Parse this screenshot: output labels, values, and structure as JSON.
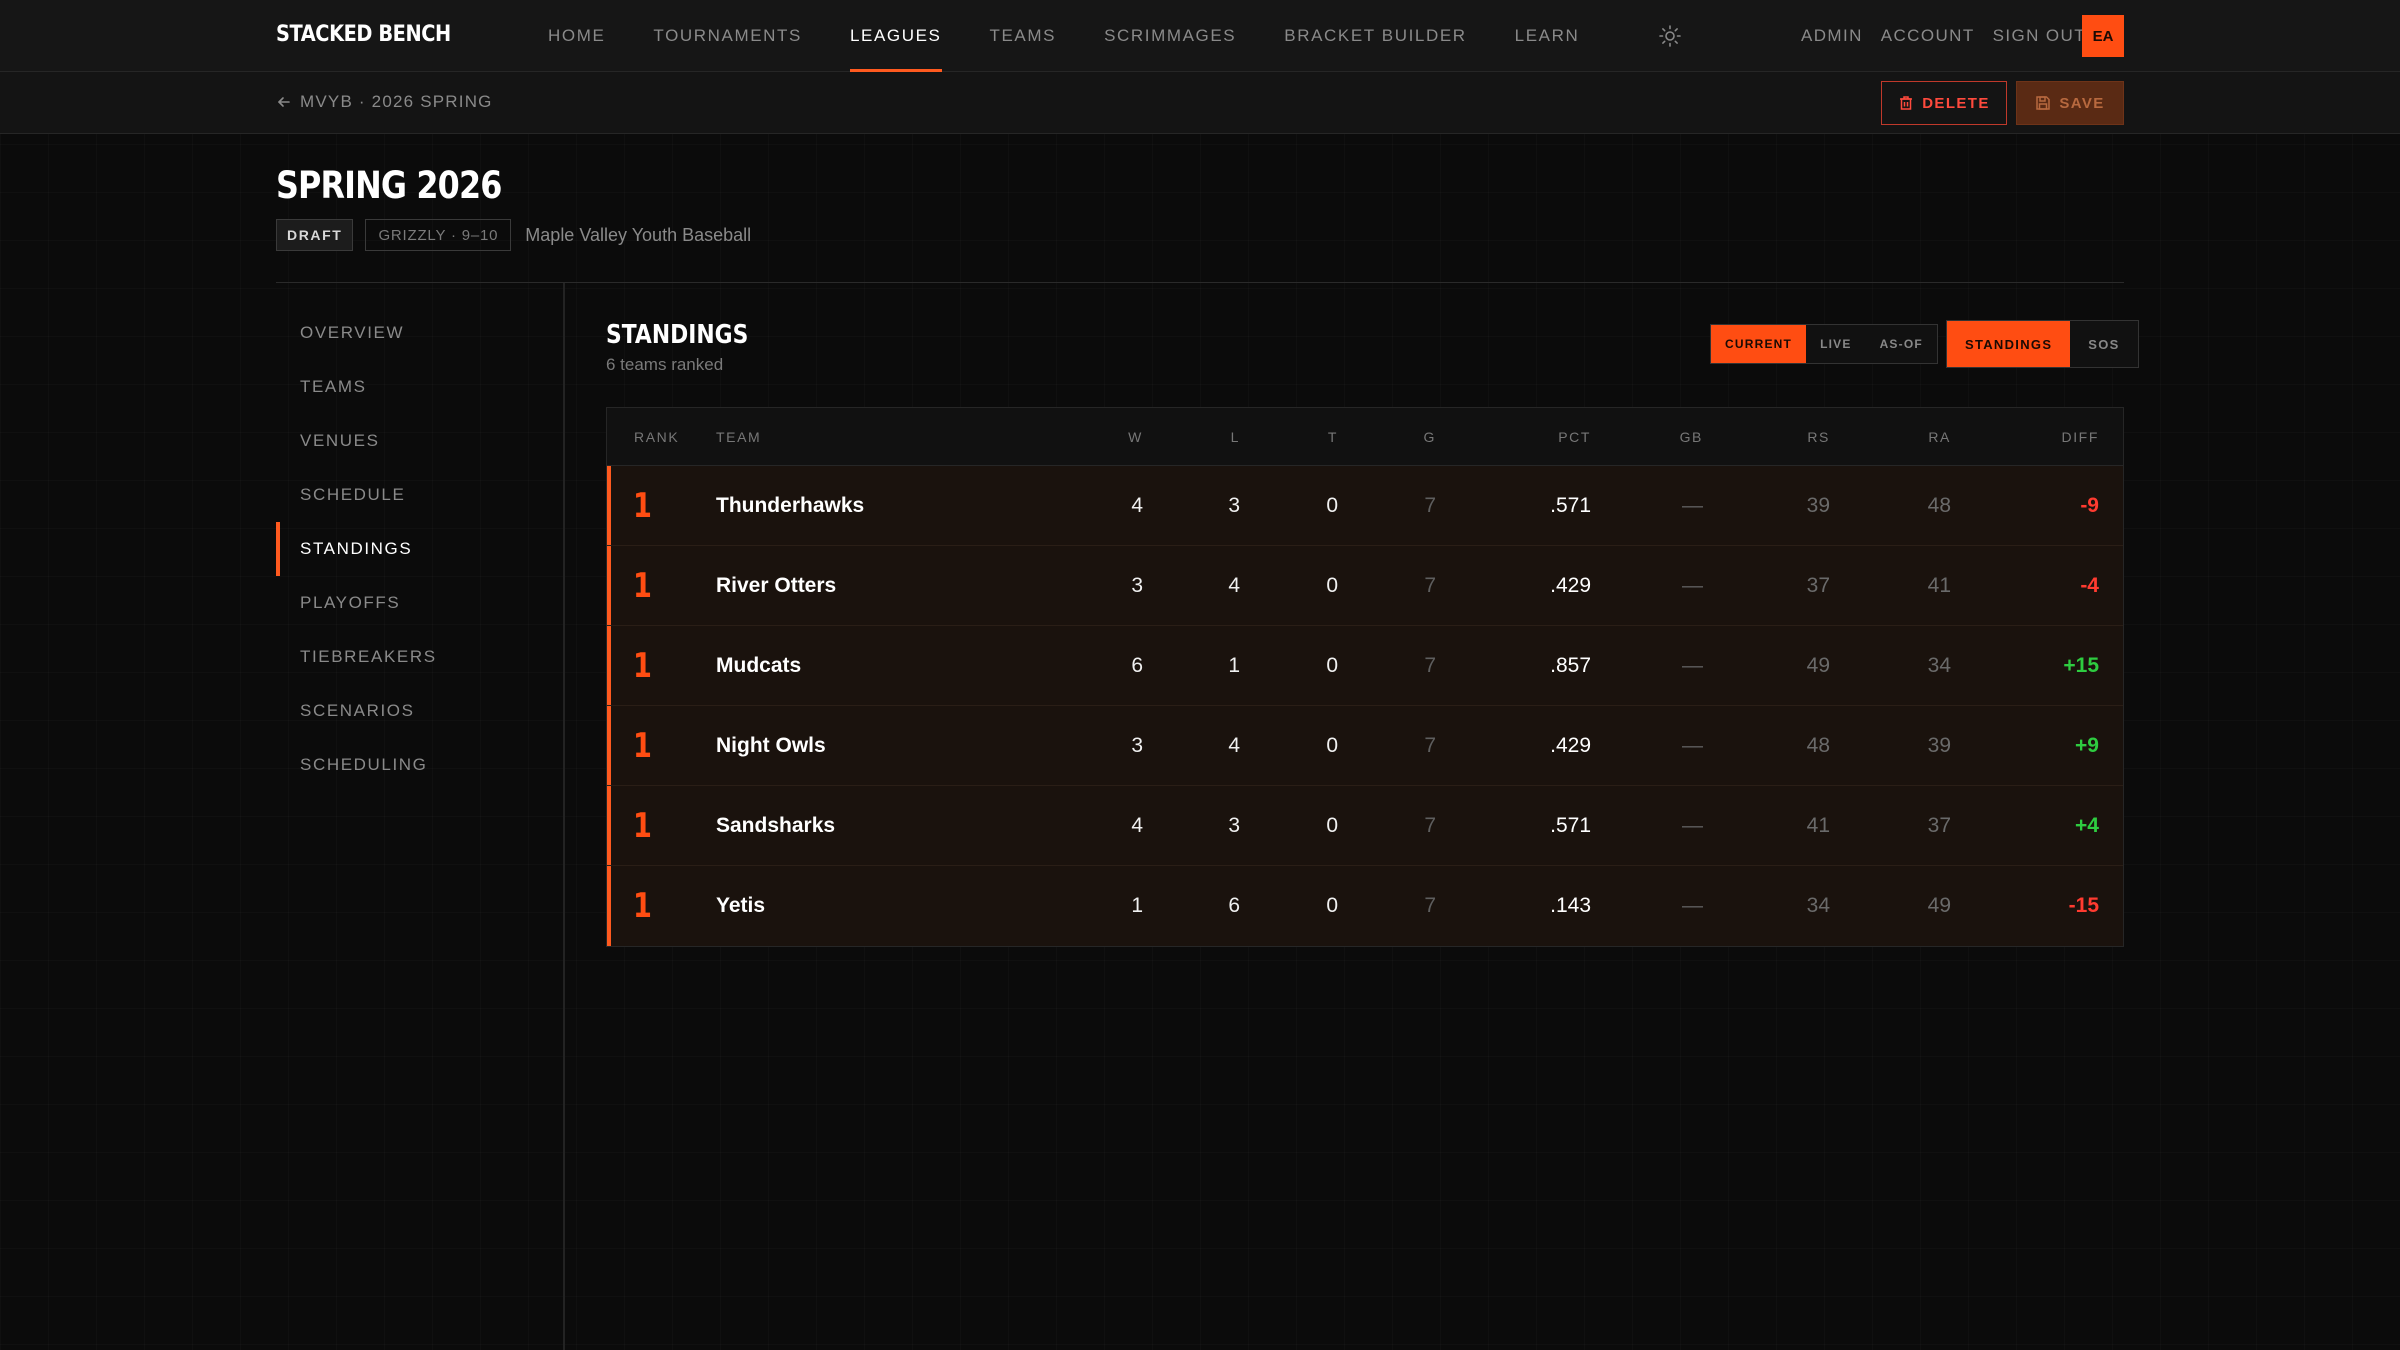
{
  "brand": "STACKED BENCH",
  "nav": {
    "links": [
      "HOME",
      "TOURNAMENTS",
      "LEAGUES",
      "TEAMS",
      "SCRIMMAGES",
      "BRACKET BUILDER",
      "LEARN"
    ],
    "active": "LEAGUES",
    "account_links": [
      "ADMIN",
      "ACCOUNT",
      "SIGN OUT"
    ],
    "avatar_initials": "EA",
    "theme_icon": "sun-icon"
  },
  "subbar": {
    "breadcrumb": "MVYB · 2026 SPRING",
    "delete_label": "DELETE",
    "save_label": "SAVE"
  },
  "page": {
    "title": "SPRING 2026",
    "status_badge": "DRAFT",
    "division_badge": "GRIZZLY · 9–10",
    "organization": "Maple Valley Youth Baseball"
  },
  "sidebar": {
    "items": [
      "OVERVIEW",
      "TEAMS",
      "VENUES",
      "SCHEDULE",
      "STANDINGS",
      "PLAYOFFS",
      "TIEBREAKERS",
      "SCENARIOS",
      "SCHEDULING"
    ],
    "active": "STANDINGS"
  },
  "standings": {
    "title": "STANDINGS",
    "subtitle": "6 teams ranked",
    "mode_toggle": [
      "CURRENT",
      "LIVE",
      "AS-OF"
    ],
    "mode_active": "CURRENT",
    "view_toggle": [
      "STANDINGS",
      "SOS"
    ],
    "view_active": "STANDINGS",
    "columns": [
      "RANK",
      "TEAM",
      "W",
      "L",
      "T",
      "G",
      "PCT",
      "GB",
      "RS",
      "RA",
      "DIFF"
    ],
    "rows": [
      {
        "rank": "1",
        "team": "Thunderhawks",
        "w": "4",
        "l": "3",
        "t": "0",
        "g": "7",
        "pct": ".571",
        "gb": "—",
        "rs": "39",
        "ra": "48",
        "diff": "-9"
      },
      {
        "rank": "1",
        "team": "River Otters",
        "w": "3",
        "l": "4",
        "t": "0",
        "g": "7",
        "pct": ".429",
        "gb": "—",
        "rs": "37",
        "ra": "41",
        "diff": "-4"
      },
      {
        "rank": "1",
        "team": "Mudcats",
        "w": "6",
        "l": "1",
        "t": "0",
        "g": "7",
        "pct": ".857",
        "gb": "—",
        "rs": "49",
        "ra": "34",
        "diff": "+15"
      },
      {
        "rank": "1",
        "team": "Night Owls",
        "w": "3",
        "l": "4",
        "t": "0",
        "g": "7",
        "pct": ".429",
        "gb": "—",
        "rs": "48",
        "ra": "39",
        "diff": "+9"
      },
      {
        "rank": "1",
        "team": "Sandsharks",
        "w": "4",
        "l": "3",
        "t": "0",
        "g": "7",
        "pct": ".571",
        "gb": "—",
        "rs": "41",
        "ra": "37",
        "diff": "+4"
      },
      {
        "rank": "1",
        "team": "Yetis",
        "w": "1",
        "l": "6",
        "t": "0",
        "g": "7",
        "pct": ".143",
        "gb": "—",
        "rs": "34",
        "ra": "49",
        "diff": "-15"
      }
    ]
  },
  "colors": {
    "accent": "#ff5a1f",
    "negative": "#ff3b30",
    "positive": "#2ecc40",
    "background": "#0b0b0b"
  }
}
